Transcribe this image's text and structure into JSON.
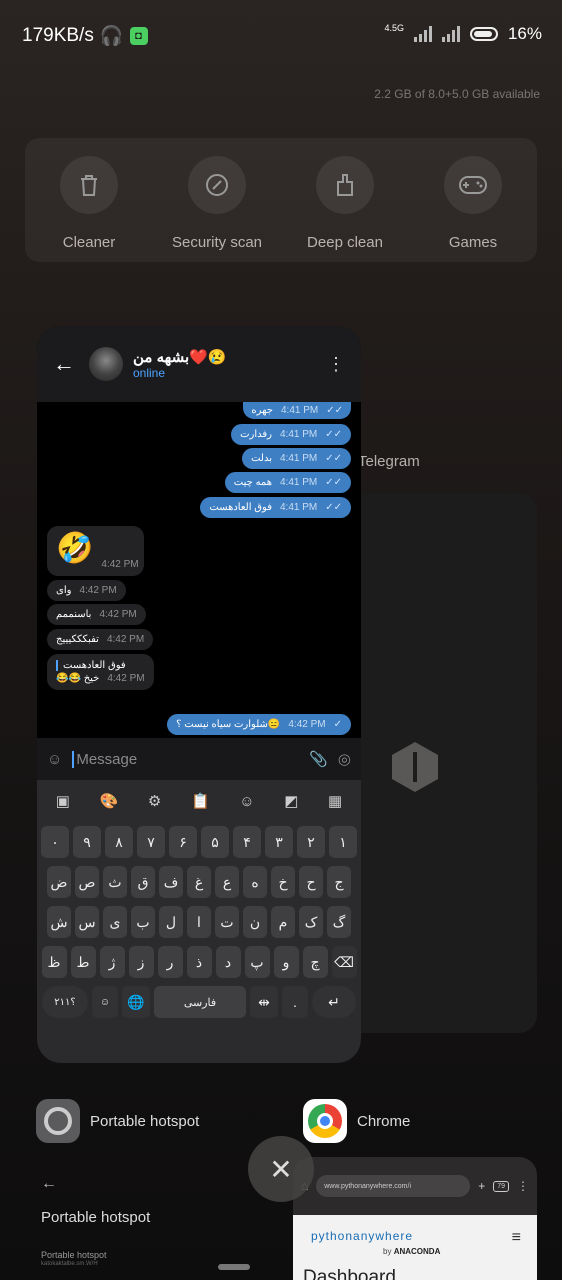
{
  "status": {
    "speed": "179KB/s",
    "network": "4.5G",
    "battery": "16%"
  },
  "memory": "2.2 GB of 8.0+5.0 GB available",
  "tools": [
    {
      "label": "Cleaner",
      "icon": "trash-icon"
    },
    {
      "label": "Security scan",
      "icon": "scan-icon"
    },
    {
      "label": "Deep clean",
      "icon": "broom-icon"
    },
    {
      "label": "Games",
      "icon": "gamepad-icon"
    }
  ],
  "telegram": {
    "app_label": "Telegram",
    "chat_name": "بشهه من❤️😢",
    "chat_status": "online",
    "messages": [
      {
        "dir": "out",
        "text": "جهره",
        "time": "4:41 PM"
      },
      {
        "dir": "out",
        "text": "رفدارت",
        "time": "4:41 PM"
      },
      {
        "dir": "out",
        "text": "بدلت",
        "time": "4:41 PM"
      },
      {
        "dir": "out",
        "text": "همه چیت",
        "time": "4:41 PM"
      },
      {
        "dir": "out",
        "text": "فوق العادهست",
        "time": "4:41 PM"
      },
      {
        "dir": "in",
        "text": "🤣",
        "time": "4:42 PM"
      },
      {
        "dir": "in",
        "text": "وای",
        "time": "4:42 PM"
      },
      {
        "dir": "in",
        "text": "باسنممم",
        "time": "4:42 PM"
      },
      {
        "dir": "in",
        "text": "تفبکککیییج",
        "time": "4:42 PM"
      },
      {
        "dir": "in",
        "quote": "فوق العادهست",
        "text": "😂😂 خیخ",
        "time": "4:42 PM"
      },
      {
        "dir": "out",
        "text": "شلوارت سیاه نیست ؟😑",
        "time": "4:42 PM"
      }
    ],
    "input_placeholder": "Message",
    "keyboard": {
      "row1": [
        "۱",
        "۲",
        "۳",
        "۴",
        "۵",
        "۶",
        "۷",
        "۸",
        "۹",
        "۰"
      ],
      "row2": [
        "ض",
        "ص",
        "ث",
        "ق",
        "ف",
        "غ",
        "ع",
        "ه",
        "خ",
        "ح",
        "ج"
      ],
      "row3": [
        "ش",
        "س",
        "ی",
        "ب",
        "ل",
        "ا",
        "ت",
        "ن",
        "م",
        "ک",
        "گ"
      ],
      "row4": [
        "ظ",
        "ط",
        "ژ",
        "ز",
        "ر",
        "ذ",
        "د",
        "پ",
        "و",
        "چ"
      ],
      "symbols_key": "؟۲۱۱",
      "space_label": "فارسی",
      "period_key": "."
    }
  },
  "background_apps": {
    "hotspot": {
      "name": "Portable hotspot",
      "preview_title": "Portable hotspot",
      "preview_sub": "Portable hotspot",
      "preview_sub2": "katokaktalbe.sm.W/H"
    },
    "chrome": {
      "name": "Chrome",
      "url": "www.pythonanywhere.com/i",
      "tab_count": "79",
      "site_logo": "pythonanywhere",
      "site_by": "by",
      "site_by_brand": "ANACONDA",
      "site_heading": "Dashboard"
    }
  }
}
